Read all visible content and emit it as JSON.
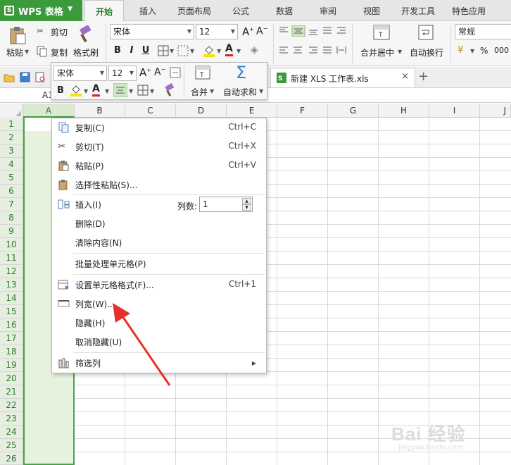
{
  "app": {
    "name": "WPS 表格"
  },
  "ribbon_tabs": [
    "开始",
    "插入",
    "页面布局",
    "公式",
    "数据",
    "审阅",
    "视图",
    "开发工具",
    "特色应用"
  ],
  "ribbon": {
    "paste": "粘贴",
    "cut": "剪切",
    "copy": "复制",
    "format_painter": "格式刷",
    "font_name": "宋体",
    "font_size": "12",
    "bold": "B",
    "italic": "I",
    "underline": "U",
    "merge_center": "合并居中",
    "auto_wrap": "自动换行",
    "number_format": "常规",
    "percent": "%"
  },
  "document_tab": {
    "name": "新建 XLS 工作表.xls",
    "close": "×",
    "new": "+"
  },
  "name_box": "A1",
  "mini_toolbar": {
    "font_name": "宋体",
    "font_size": "12",
    "bold": "B",
    "merge": "合并",
    "autosum": "自动求和"
  },
  "columns": [
    "A",
    "B",
    "C",
    "D",
    "E",
    "F",
    "G",
    "H",
    "I",
    "J"
  ],
  "rows": [
    "1",
    "2",
    "3",
    "4",
    "5",
    "6",
    "7",
    "8",
    "9",
    "10",
    "11",
    "12",
    "13",
    "14",
    "15",
    "16",
    "17",
    "18",
    "19",
    "20",
    "21",
    "22",
    "23",
    "24",
    "25",
    "26"
  ],
  "context_menu": {
    "items": [
      {
        "label": "复制(C)",
        "shortcut": "Ctrl+C",
        "icon": "copy-icon"
      },
      {
        "label": "剪切(T)",
        "shortcut": "Ctrl+X",
        "icon": "scissors-icon"
      },
      {
        "label": "粘贴(P)",
        "shortcut": "Ctrl+V",
        "icon": "paste-icon"
      },
      {
        "label": "选择性粘贴(S)...",
        "shortcut": "",
        "icon": "paste-special-icon"
      },
      {
        "label": "插入(I)",
        "shortcut": "",
        "icon": "insert-column-icon"
      },
      {
        "label": "删除(D)",
        "shortcut": "",
        "icon": ""
      },
      {
        "label": "清除内容(N)",
        "shortcut": "",
        "icon": ""
      },
      {
        "label": "批量处理单元格(P)",
        "shortcut": "",
        "icon": ""
      },
      {
        "label": "设置单元格格式(F)...",
        "shortcut": "Ctrl+1",
        "icon": "format-cells-icon"
      },
      {
        "label": "列宽(W)...",
        "shortcut": "",
        "icon": "column-width-icon"
      },
      {
        "label": "隐藏(H)",
        "shortcut": "",
        "icon": ""
      },
      {
        "label": "取消隐藏(U)",
        "shortcut": "",
        "icon": ""
      },
      {
        "label": "筛选列",
        "shortcut": "",
        "icon": "filter-column-icon"
      }
    ],
    "insert_count_label": "列数:",
    "insert_count_value": "1"
  },
  "colors": {
    "accent": "#3b9b3b",
    "selection_fill": "#e7f2de",
    "arrow": "#e8302a"
  },
  "watermark": {
    "brand": "Bai 经验",
    "url": "jingyan.baidu.com"
  }
}
